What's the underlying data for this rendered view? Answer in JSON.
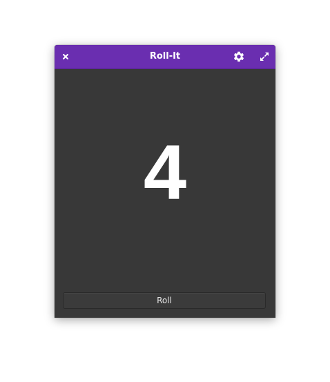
{
  "window": {
    "title": "Roll-It"
  },
  "titlebar": {
    "close_icon": "close-icon",
    "settings_icon": "gear-icon",
    "maximize_icon": "maximize-icon"
  },
  "main": {
    "result": "4",
    "roll_label": "Roll"
  },
  "colors": {
    "accent": "#6a2eb0",
    "background": "#383838",
    "text": "#ffffff"
  }
}
